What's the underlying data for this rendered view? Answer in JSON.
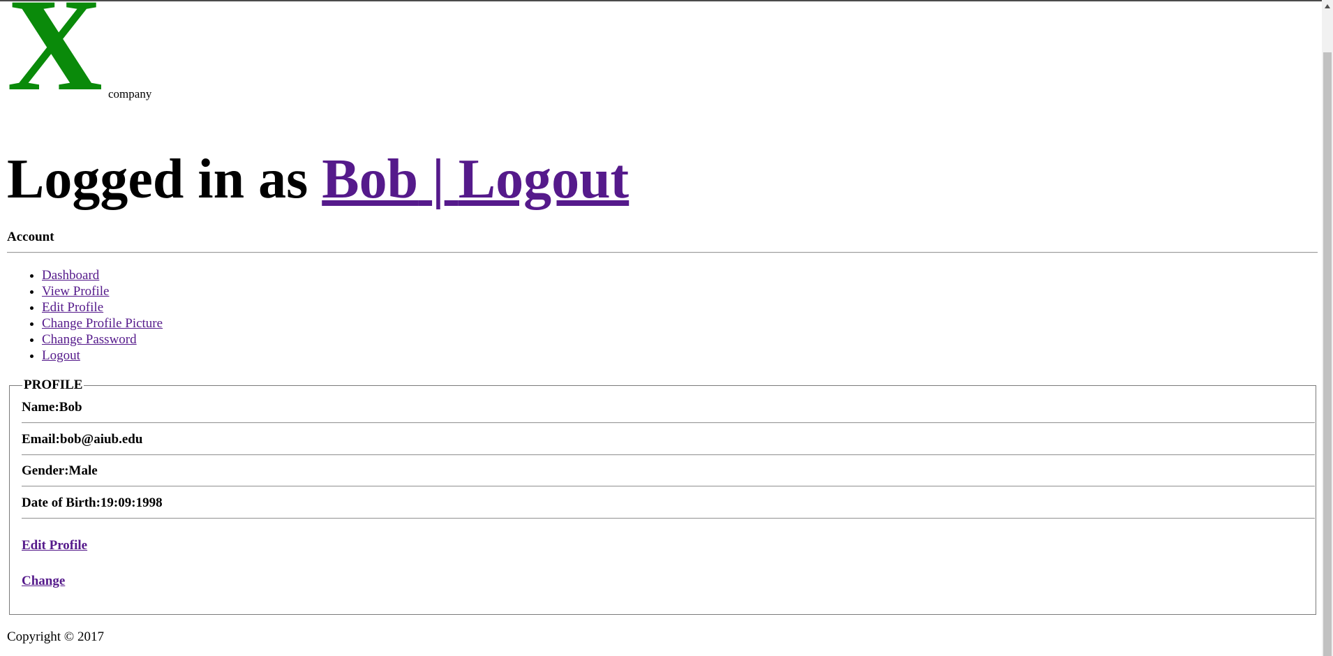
{
  "logo": {
    "letter": "X",
    "subtext": "company",
    "color": "#0a8a0a"
  },
  "header": {
    "logged_in_text": "Logged in as",
    "user_link": "Bob",
    "separator": "|",
    "logout_link": "Logout"
  },
  "account": {
    "label": "Account"
  },
  "nav": {
    "items": [
      {
        "label": "Dashboard"
      },
      {
        "label": "View Profile"
      },
      {
        "label": "Edit Profile"
      },
      {
        "label": "Change Profile Picture"
      },
      {
        "label": "Change Password"
      },
      {
        "label": "Logout"
      }
    ]
  },
  "profile": {
    "legend": "PROFILE",
    "name": "Name:Bob",
    "email": "Email:bob@aiub.edu",
    "gender": "Gender:Male",
    "dob": "Date of Birth:19:09:1998",
    "edit_link": "Edit Profile",
    "change_link": "Change"
  },
  "footer": {
    "copyright": "Copyright © 2017"
  },
  "colors": {
    "link": "#551a8b"
  }
}
